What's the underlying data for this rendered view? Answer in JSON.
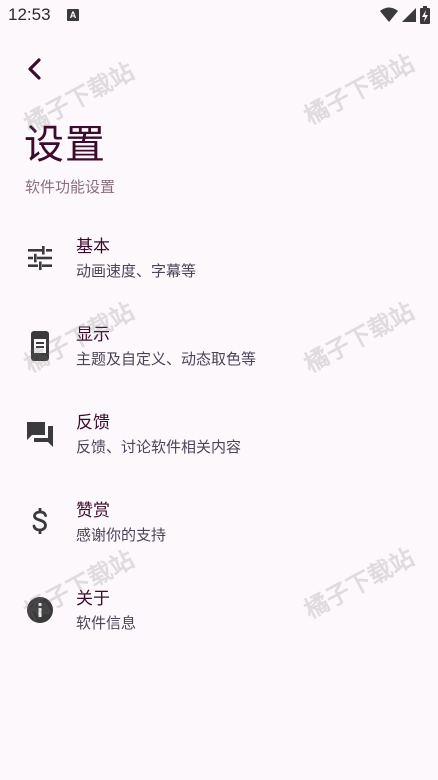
{
  "status_bar": {
    "time": "12:53",
    "notification_glyph": "A"
  },
  "header": {
    "title": "设置",
    "subtitle": "软件功能设置"
  },
  "menu": [
    {
      "title": "基本",
      "desc": "动画速度、字幕等",
      "icon": "tune-icon"
    },
    {
      "title": "显示",
      "desc": "主题及自定义、动态取色等",
      "icon": "phone-display-icon"
    },
    {
      "title": "反馈",
      "desc": "反馈、讨论软件相关内容",
      "icon": "forum-icon"
    },
    {
      "title": "赞赏",
      "desc": "感谢你的支持",
      "icon": "dollar-icon"
    },
    {
      "title": "关于",
      "desc": "软件信息",
      "icon": "info-icon"
    }
  ],
  "watermark": "橘子下载站",
  "colors": {
    "background": "#fdf8fc",
    "title": "#3b0a2d",
    "subtitle": "#8a6f80",
    "icon": "#3a3a3a"
  }
}
